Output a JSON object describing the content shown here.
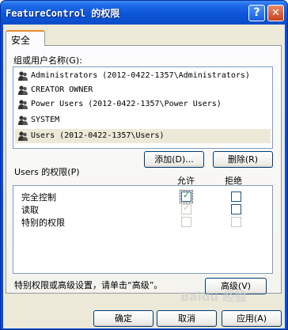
{
  "window": {
    "title": "FeatureControl 的权限",
    "help_glyph": "?",
    "close_glyph": "✕"
  },
  "tab": {
    "label": "安全"
  },
  "users": {
    "label": "组或用户名称(G):",
    "items": [
      {
        "name": "Administrators (2012-0422-1357\\Administrators)",
        "icon": "user-group-icon"
      },
      {
        "name": "CREATOR OWNER",
        "icon": "user-group-icon"
      },
      {
        "name": "Power Users (2012-0422-1357\\Power Users)",
        "icon": "user-group-icon"
      },
      {
        "name": "SYSTEM",
        "icon": "user-group-icon"
      },
      {
        "name": "Users (2012-0422-1357\\Users)",
        "icon": "user-group-icon",
        "selected": true
      }
    ],
    "add_button": "添加(D)...",
    "remove_button": "删除(R)"
  },
  "permissions": {
    "label": "Users 的权限(P)",
    "allow_header": "允许",
    "deny_header": "拒绝",
    "rows": [
      {
        "name": "完全控制",
        "allow": true,
        "allow_disabled": false,
        "deny": false,
        "deny_disabled": false
      },
      {
        "name": "读取",
        "allow": true,
        "allow_disabled": true,
        "deny": false,
        "deny_disabled": false
      },
      {
        "name": "特别的权限",
        "allow": false,
        "allow_disabled": true,
        "deny": false,
        "deny_disabled": true
      }
    ]
  },
  "advanced": {
    "hint": "特别权限或高级设置，请单击“高级”。",
    "button": "高级(V)"
  },
  "footer": {
    "ok": "确定",
    "cancel": "取消",
    "apply": "应用(A)"
  },
  "watermark": "Baidu 经验",
  "colors": {
    "titlebar": "#0c56d8",
    "dialog_bg": "#ece9d8",
    "check": "#21a121"
  }
}
